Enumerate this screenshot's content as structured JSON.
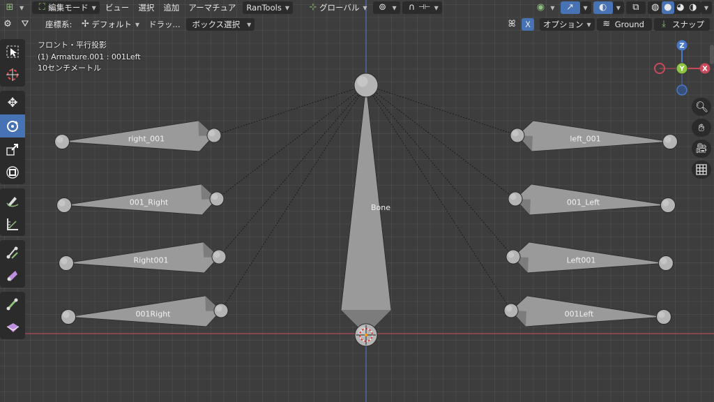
{
  "header": {
    "mode_label": "編集モード",
    "menu": [
      "ビュー",
      "選択",
      "追加",
      "アーマチュア"
    ],
    "addon_label": "RanTools",
    "orientation_label": "グローバル"
  },
  "toolsettings": {
    "coord_label": "座標系:",
    "coord_value": "デフォルト",
    "drag_label": "ドラッ...",
    "drag_value": "ボックス選択",
    "x_label": "X",
    "options_label": "オプション",
    "ground_label": "Ground",
    "snap_label": "スナップ"
  },
  "overlay": {
    "view_name": "フロント・平行投影",
    "active_object": "(1) Armature.001 : 001Left",
    "scale": "10センチメートル"
  },
  "gizmo": {
    "z": "Z",
    "y": "Y",
    "x": "X"
  },
  "bones": [
    {
      "name": "right_001"
    },
    {
      "name": "001_Right"
    },
    {
      "name": "Right001"
    },
    {
      "name": "001Right"
    },
    {
      "name": "left_001"
    },
    {
      "name": "001_Left"
    },
    {
      "name": "Left001"
    },
    {
      "name": "001Left"
    },
    {
      "name": "Bone"
    }
  ],
  "colors": {
    "accent": "#4772b3",
    "viewport_bg": "#3d3d3d",
    "bone_fill": "#9a9a9a",
    "x_axis": "#c84a5a",
    "z_axis": "#4a78c8"
  }
}
